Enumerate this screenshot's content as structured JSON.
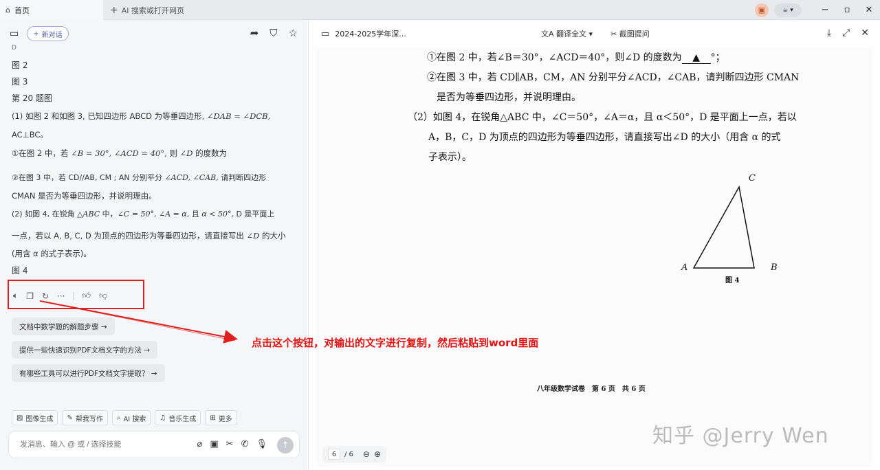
{
  "tabs": {
    "home_label": "首页",
    "new_tab_label": "AI 搜索或打开网页"
  },
  "left": {
    "new_chat_label": "新对话",
    "lines": {
      "l0": "D",
      "l1": "图 2",
      "l2": "图 3",
      "l3": "第 20 题图",
      "l4a": "(1) 如图 2 和如图 3, 已知四边形 ABCD 为等垂四边形, ",
      "l4m": "∠DAB = ∠DCB,",
      "l5": "AC⊥BC。",
      "l6a": "①在图 2 中，若 ",
      "l6m": "∠B = 30°, ∠ACD = 40°,",
      "l6b": " 则 ",
      "l6m2": "∠D",
      "l6c": " 的度数为",
      "l7a": "②在图 3 中，若 CD//AB, CM ; AN 分别平分 ",
      "l7m": "∠ACD, ∠CAB,",
      "l7b": " 请判断四边形",
      "l8": "CMAN 是否为等垂四边形，并说明理由。",
      "l9a": "(2) 如图 4, 在锐角 ",
      "l9m": "△ABC",
      "l9b": " 中，",
      "l9m2": "∠C = 50°, ∠A = α,",
      "l9c": " 且 ",
      "l9m3": "α < 50°,",
      "l9d": " D 是平面上",
      "l10a": "一点，若以 A, B, C, D 为顶点的四边形为等垂四边形，请直接写出 ",
      "l10m": "∠D",
      "l10b": " 的大小",
      "l11": "(用含 α 的式子表示)。",
      "l12": "图 4"
    },
    "suggestions": [
      "文档中数学题的解题步骤 →",
      "提供一些快速识别PDF文档文字的方法 →",
      "有哪些工具可以进行PDF文档文字提取？ →"
    ],
    "tools": [
      "图像生成",
      "帮我写作",
      "AI 搜索",
      "音乐生成",
      "更多"
    ],
    "input_placeholder": "发消息、输入 @ 或 / 选择技能"
  },
  "right": {
    "doc_title": "2024-2025学年深...",
    "translate_label": "翻译全文",
    "screenshot_label": "截图提问",
    "q1": "①在图 2 中，若∠B＝30°，∠ACD＝40°，则∠D 的度数为",
    "q1_blank": "▲",
    "q1_end": "°；",
    "q2": "②在图 3 中，若 CD∥AB，CM，AN 分别平分∠ACD，∠CAB，请判断四边形 CMAN",
    "q3": "是否为等垂四边形，并说明理由。",
    "q4": "（2）如图 4，在锐角△ABC 中，∠C＝50°，∠A＝α，且 α＜50°，D 是平面上一点，若以",
    "q5": "A，B，C，D 为顶点的四边形为等垂四边形，请直接写出∠D 的大小（用含 α 的式",
    "q6": "子表示）。",
    "fig_labels": {
      "a": "A",
      "b": "B",
      "c": "C",
      "caption": "图 4"
    },
    "footer": "八年级数学试卷　第 6 页　共 6 页",
    "watermark": "知乎 @Jerry Wen",
    "pager_current": "6",
    "pager_total": "/ 6"
  },
  "annotation": "点击这个按钮，对输出的文字进行复制，然后粘贴到word里面"
}
